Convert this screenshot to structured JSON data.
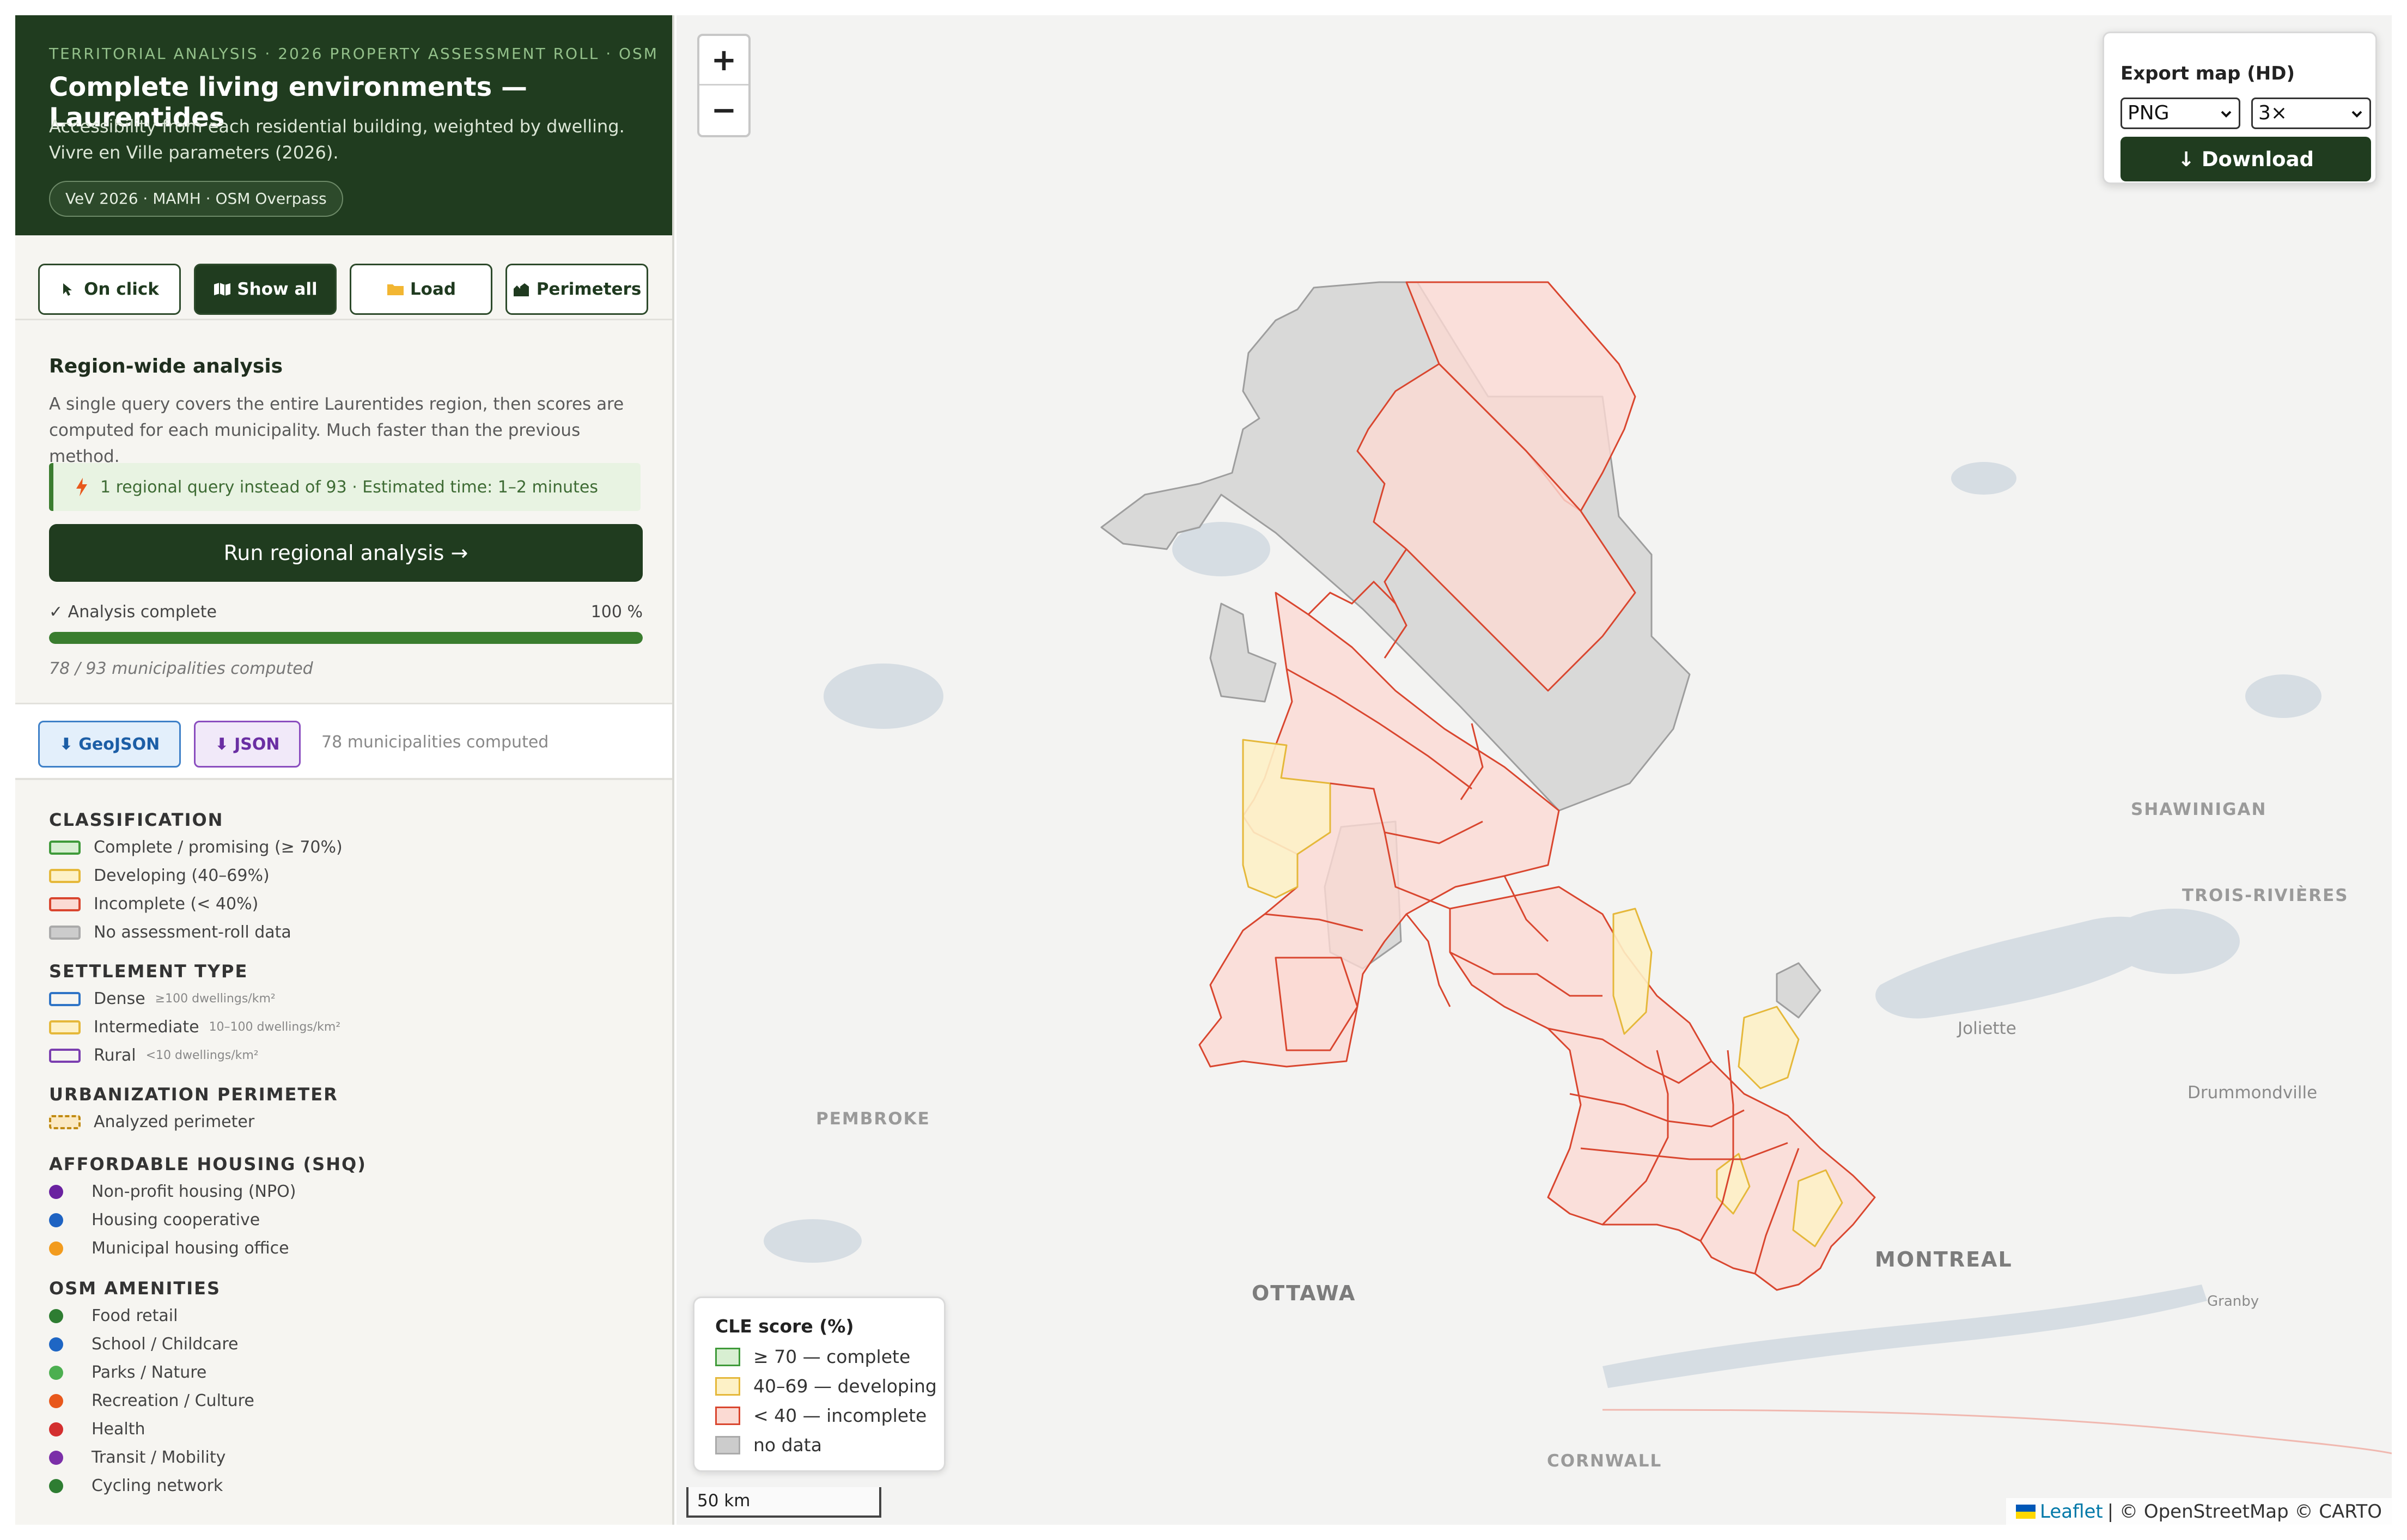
{
  "sidebar": {
    "header": {
      "kicker": "TERRITORIAL ANALYSIS · 2026 PROPERTY ASSESSMENT ROLL · OSM",
      "title": "Complete living environments — Laurentides",
      "subtitle": "Accessibility from each residential building, weighted by dwelling. Vivre en Ville parameters (2026).",
      "sources": "VeV 2026 · MAMH · OSM Overpass"
    },
    "modes": [
      {
        "label": "On click",
        "icon": "cursor-icon",
        "active": false
      },
      {
        "label": "Show all",
        "icon": "map-icon",
        "active": true
      },
      {
        "label": "Load",
        "icon": "folder-icon",
        "active": false
      },
      {
        "label": "Perimeters",
        "icon": "city-icon",
        "active": false
      }
    ],
    "region": {
      "title": "Region-wide analysis",
      "description": "A single query covers the entire Laurentides region, then scores are computed for each municipality. Much faster than the previous method.",
      "tip": "1 regional query instead of 93 · Estimated time: 1–2 minutes",
      "run_button": "Run regional analysis →",
      "status": "✓ Analysis complete",
      "progress_label": "100 %",
      "progress": 1.0,
      "count": "78 / 93 municipalities computed"
    },
    "export": {
      "geojson": "⬇ GeoJSON",
      "json": "⬇ JSON",
      "note": "78 municipalities computed"
    },
    "legend": {
      "classification": {
        "title": "CLASSIFICATION",
        "items": [
          {
            "label": "Complete / promising (≥ 70%)",
            "fill": "#d8efd2",
            "stroke": "#3f9a3a"
          },
          {
            "label": "Developing (40–69%)",
            "fill": "#fdf1c6",
            "stroke": "#e5b83a"
          },
          {
            "label": "Incomplete (< 40%)",
            "fill": "#fbdad3",
            "stroke": "#d9462f"
          },
          {
            "label": "No assessment-roll data",
            "fill": "#cccccc",
            "stroke": "#aaaaaa"
          }
        ]
      },
      "settlement": {
        "title": "SETTLEMENT TYPE",
        "items": [
          {
            "label": "Dense",
            "note": "≥100 dwellings/km²",
            "stroke": "#2f74c6"
          },
          {
            "label": "Intermediate",
            "note": "10–100 dwellings/km²",
            "stroke": "#e5b83a"
          },
          {
            "label": "Rural",
            "note": "<10 dwellings/km²",
            "stroke": "#7b3fb0"
          }
        ]
      },
      "perimeter": {
        "title": "URBANIZATION PERIMETER",
        "items": [
          {
            "label": "Analyzed perimeter",
            "stroke": "#c08a12"
          }
        ]
      },
      "housing": {
        "title": "AFFORDABLE HOUSING (SHQ)",
        "items": [
          {
            "label": "Non-profit housing (NPO)",
            "color": "#6a22a0"
          },
          {
            "label": "Housing cooperative",
            "color": "#1f63c2"
          },
          {
            "label": "Municipal housing office",
            "color": "#f29b1e"
          }
        ]
      },
      "amenities": {
        "title": "OSM AMENITIES",
        "items": [
          {
            "label": "Food retail",
            "color": "#2e7d32"
          },
          {
            "label": "School / Childcare",
            "color": "#1e66c4"
          },
          {
            "label": "Parks / Nature",
            "color": "#4caf50"
          },
          {
            "label": "Recreation / Culture",
            "color": "#e8581c"
          },
          {
            "label": "Health",
            "color": "#d32f2f"
          },
          {
            "label": "Transit / Mobility",
            "color": "#7b2fa8"
          },
          {
            "label": "Cycling network",
            "color": "#2e7d32"
          }
        ]
      }
    }
  },
  "map": {
    "zoom_in": "+",
    "zoom_out": "−",
    "export_panel": {
      "title": "Export map (HD)",
      "format": "PNG",
      "scale": "3×",
      "download": "↓ Download"
    },
    "cities": [
      "SHAWINIGAN",
      "TROIS-RIVIÈRES",
      "Joliette",
      "Drummondville",
      "PEMBROKE",
      "OTTAWA",
      "MONTREAL",
      "Granby",
      "CORNWALL"
    ],
    "cle_legend": {
      "title": "CLE score (%)",
      "items": [
        {
          "label": "≥ 70 — complete",
          "fill": "#d8efd2",
          "stroke": "#3f9a3a"
        },
        {
          "label": "40–69 — developing",
          "fill": "#fdf1c6",
          "stroke": "#e5b83a"
        },
        {
          "label": "< 40 — incomplete",
          "fill": "#fbdad3",
          "stroke": "#d9462f"
        },
        {
          "label": "no data",
          "fill": "#cccccc",
          "stroke": "#aaaaaa"
        }
      ]
    },
    "scale": "50 km",
    "attribution": {
      "leaflet": "Leaflet",
      "rest": "| © OpenStreetMap © CARTO"
    }
  }
}
